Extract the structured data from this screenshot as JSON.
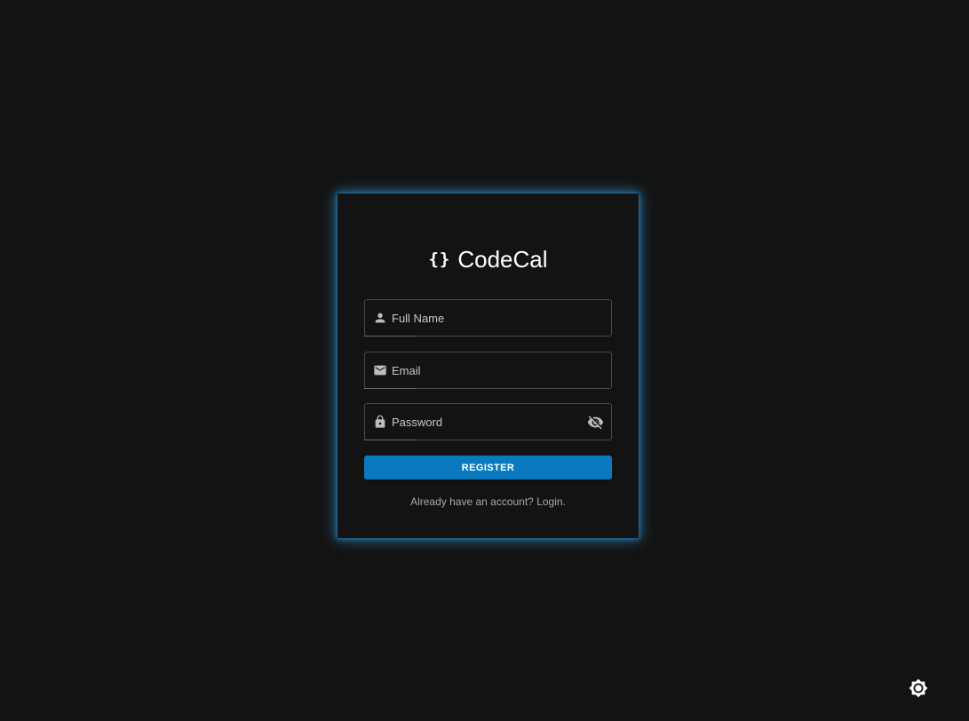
{
  "brand": {
    "mark": "{}",
    "name": "CodeCal"
  },
  "form": {
    "full_name": {
      "placeholder": "Full Name",
      "value": "",
      "icon": "person-icon"
    },
    "email": {
      "placeholder": "Email",
      "value": "",
      "icon": "mail-icon"
    },
    "password": {
      "placeholder": "Password",
      "value": "",
      "icon": "lock-icon",
      "toggle_icon": "eye-off-icon"
    },
    "register_label": "REGISTER",
    "login_link": "Already have an account? Login."
  },
  "theme_toggle": {
    "icon": "brightness-icon"
  },
  "colors": {
    "background": "#131313",
    "accent": "#0a79c0",
    "glow": "#2980b9"
  }
}
